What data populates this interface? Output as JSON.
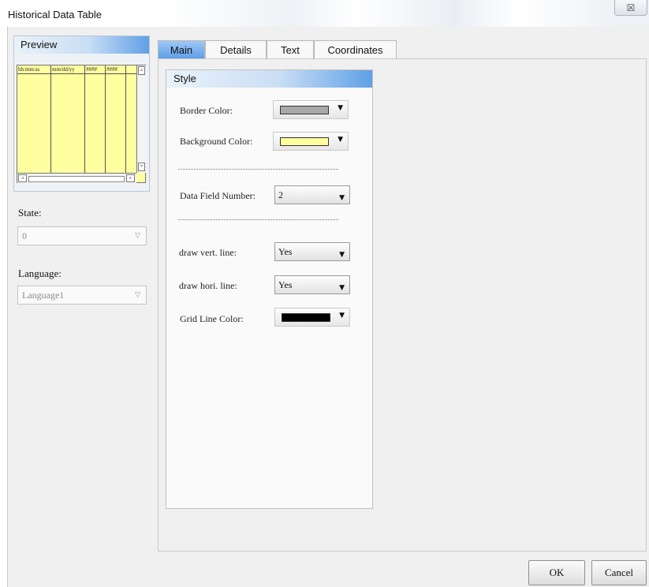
{
  "window": {
    "title": "Historical Data Table",
    "close_glyph": "☒"
  },
  "preview": {
    "header": "Preview",
    "columns": [
      "hh:mm:ss",
      "mm/dd/yy",
      "####",
      "####"
    ],
    "background": "#ffffa0",
    "scroll_up": "▵",
    "scroll_down": "▿",
    "scroll_left": "◃",
    "scroll_right": "▹"
  },
  "left": {
    "state_label": "State:",
    "state_value": "0",
    "language_label": "Language:",
    "language_value": "Language1"
  },
  "tabs": [
    {
      "label": "Main",
      "active": true
    },
    {
      "label": "Details",
      "active": false
    },
    {
      "label": "Text",
      "active": false
    },
    {
      "label": "Coordinates",
      "active": false
    }
  ],
  "style": {
    "header": "Style",
    "border_color_label": "Border Color:",
    "border_color": "#a8a8a8",
    "background_color_label": "Background Color:",
    "background_color": "#ffffa0",
    "data_field_number_label": "Data Field Number:",
    "data_field_number": "2",
    "draw_vert_label": "draw vert. line:",
    "draw_vert_value": "Yes",
    "draw_hori_label": "draw hori. line:",
    "draw_hori_value": "Yes",
    "grid_line_color_label": "Grid Line Color:",
    "grid_line_color": "#000000"
  },
  "icons": {
    "dropdown": "▼",
    "chevron": "▽"
  },
  "buttons": {
    "ok": "OK",
    "cancel": "Cancel"
  }
}
